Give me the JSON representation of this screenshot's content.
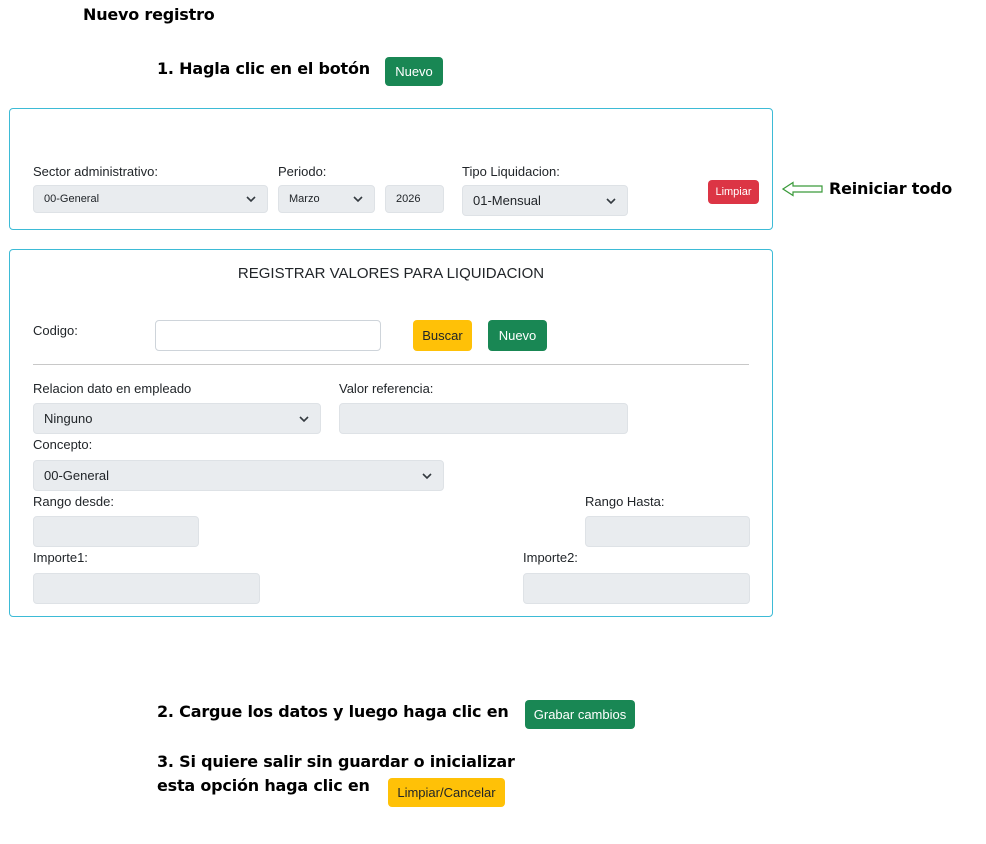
{
  "header": {
    "title": "Nuevo registro"
  },
  "steps": {
    "step1": "1. Hagla clic en el botón",
    "step1_button": "Nuevo",
    "step2": "2. Cargue los datos y luego haga clic en",
    "step2_button": "Grabar cambios",
    "step3_line1": "3.  Si quiere salir sin guardar o inicializar",
    "step3_line2": "esta opción haga clic en",
    "step3_button": "Limpiar/Cancelar"
  },
  "filters": {
    "sector_label": "Sector administrativo:",
    "sector_value": "00-General",
    "periodo_label": "Periodo:",
    "periodo_month": "Marzo",
    "periodo_year": "2026",
    "tipo_label": "Tipo Liquidacion:",
    "tipo_value": "01-Mensual",
    "limpiar_button": "Limpiar"
  },
  "annotation": {
    "reset_text": "Reiniciar todo"
  },
  "form": {
    "title": "REGISTRAR VALORES PARA LIQUIDACION",
    "codigo_label": "Codigo:",
    "codigo_value": "",
    "buscar_button": "Buscar",
    "nuevo_button": "Nuevo",
    "relacion_label": "Relacion dato en empleado",
    "relacion_value": "Ninguno",
    "valor_ref_label": "Valor referencia:",
    "concepto_label": "Concepto:",
    "concepto_value": "00-General",
    "rango_desde_label": "Rango desde:",
    "rango_hasta_label": "Rango Hasta:",
    "importe1_label": "Importe1:",
    "importe2_label": "Importe2:"
  },
  "colors": {
    "green": "#198754",
    "yellow": "#ffc107",
    "red": "#dc3545",
    "panel_border": "#3dbbd6",
    "arrow": "#3a9a3a"
  }
}
